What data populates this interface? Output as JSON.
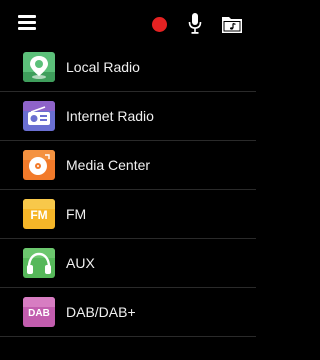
{
  "topbar": {
    "icons": [
      "menu-icon",
      "record-icon",
      "microphone-icon",
      "folder-music-icon"
    ],
    "record_color": "#e52222"
  },
  "menu": {
    "items": [
      {
        "label": "Local Radio",
        "icon": "location-pin-icon",
        "color": "#5cc07a"
      },
      {
        "label": "Internet Radio",
        "icon": "radio-icon",
        "color": "#6a6fd1"
      },
      {
        "label": "Media Center",
        "icon": "disc-icon",
        "color": "#f27a2a"
      },
      {
        "label": "FM",
        "icon": "fm-icon",
        "color": "#f6b628",
        "icon_text": "FM"
      },
      {
        "label": "AUX",
        "icon": "headphones-icon",
        "color": "#56b85a"
      },
      {
        "label": "DAB/DAB+",
        "icon": "dab-icon",
        "color": "#c25dae",
        "icon_text": "DAB"
      }
    ]
  }
}
